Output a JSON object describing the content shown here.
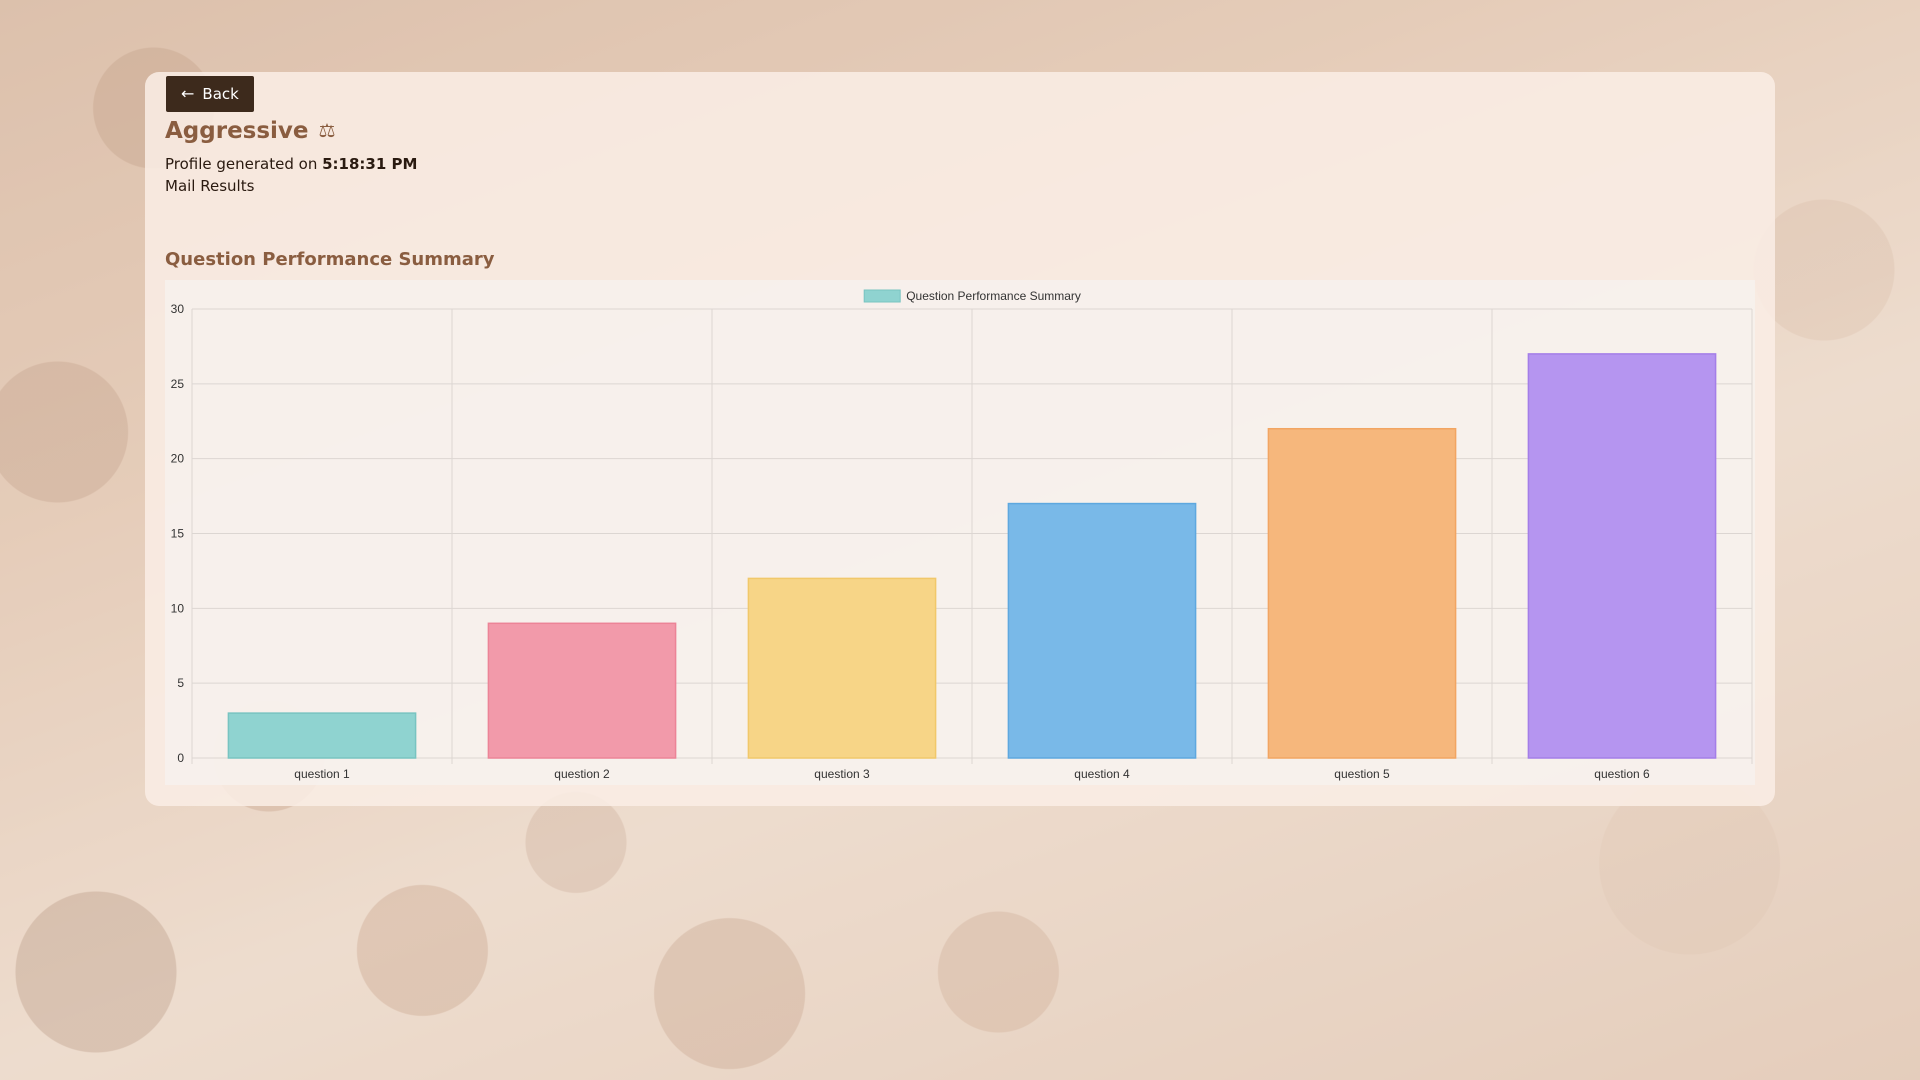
{
  "header": {
    "back_label": "Back",
    "title": "Aggressive",
    "title_icon": "scale-icon",
    "profile_prefix": "Profile generated on",
    "profile_time": "5:18:31 PM",
    "mail_label": "Mail Results"
  },
  "section": {
    "title": "Question Performance Summary"
  },
  "colors": {
    "primary_button": "#3d2a1c",
    "accent_text": "#8a5d40"
  },
  "chart_data": {
    "type": "bar",
    "title": "",
    "xlabel": "",
    "ylabel": "",
    "ylim": [
      0,
      30
    ],
    "yticks": [
      0,
      5,
      10,
      15,
      20,
      25,
      30
    ],
    "grid": true,
    "legend_position": "top",
    "categories": [
      "question 1",
      "question 2",
      "question 3",
      "question 4",
      "question 5",
      "question 6"
    ],
    "series": [
      {
        "name": "Question Performance Summary",
        "values": [
          3,
          9,
          12,
          17,
          22,
          27
        ],
        "colors": [
          "#8fd3d0",
          "#f29aaa",
          "#f7d587",
          "#79b9e8",
          "#f6b77c",
          "#b595f0"
        ],
        "border_colors": [
          "#78c4c1",
          "#ec8497",
          "#f1c86a",
          "#5ea8df",
          "#f2a562",
          "#a47ee8"
        ]
      }
    ]
  }
}
